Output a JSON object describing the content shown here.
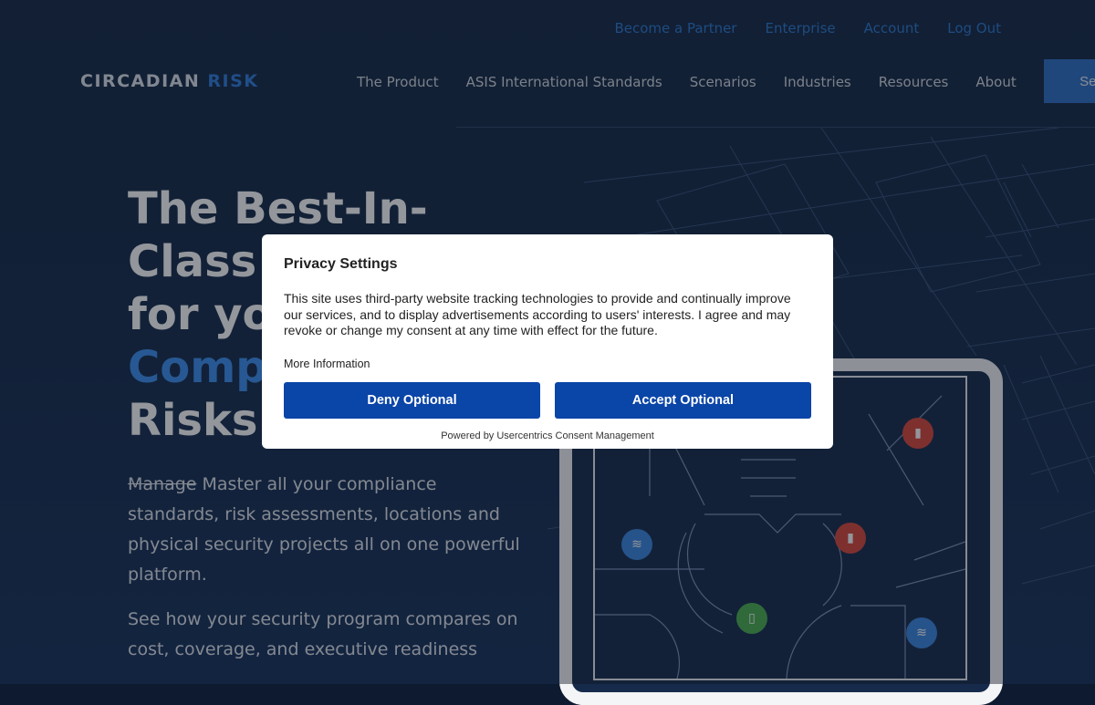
{
  "utility_nav": [
    "Become a Partner",
    "Enterprise",
    "Account",
    "Log Out"
  ],
  "logo": {
    "part1": "CIRCADIAN",
    "part2": "RISK"
  },
  "main_nav": [
    "The Product",
    "ASIS International Standards",
    "Scenarios",
    "Industries",
    "Resources",
    "About"
  ],
  "cta": {
    "label": "See"
  },
  "hero": {
    "title_line1": "The Best-In-",
    "title_line2": "Class",
    "title_line3": "for yo",
    "title_accent": "Comp",
    "title_line5": "Risks",
    "copy_struck": "Manage",
    "copy_rest": " Master all your compliance standards, risk assessments, locations and physical security projects all on one powerful platform.",
    "copy2": "See how your security program compares on cost, coverage, and executive readiness"
  },
  "modal": {
    "title": "Privacy Settings",
    "body": "This site uses third-party website tracking technologies to provide and continually improve our services, and to display advertisements according to users' interests. I agree and may revoke or change my consent at any time with effect for the future.",
    "more_info": "More Information",
    "deny_label": "Deny Optional",
    "accept_label": "Accept Optional",
    "powered_by": "Powered by Usercentrics Consent Management"
  },
  "colors": {
    "accent": "#2f7ddc",
    "modal_button": "#0a45a8",
    "pin_red": "#d9453b",
    "pin_blue": "#3a86e0",
    "pin_green": "#4caf50"
  }
}
